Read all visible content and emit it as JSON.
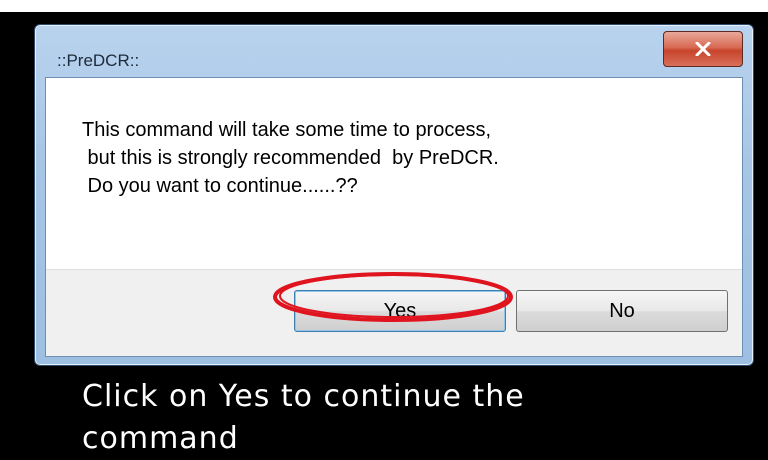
{
  "dialog": {
    "title": "::PreDCR::",
    "message_lines": [
      "This command will take some time to process,",
      " but this is strongly recommended  by PreDCR.",
      " Do you want to continue......??"
    ],
    "buttons": {
      "yes": "Yes",
      "no": "No"
    },
    "close_icon": "close-icon"
  },
  "caption": {
    "line1": "Click on Yes to continue the",
    "line2": "command"
  },
  "colors": {
    "frame": "#a7c6e6",
    "close_button": "#c8442c",
    "annotation_ring": "#e0141e",
    "background": "#000000"
  }
}
